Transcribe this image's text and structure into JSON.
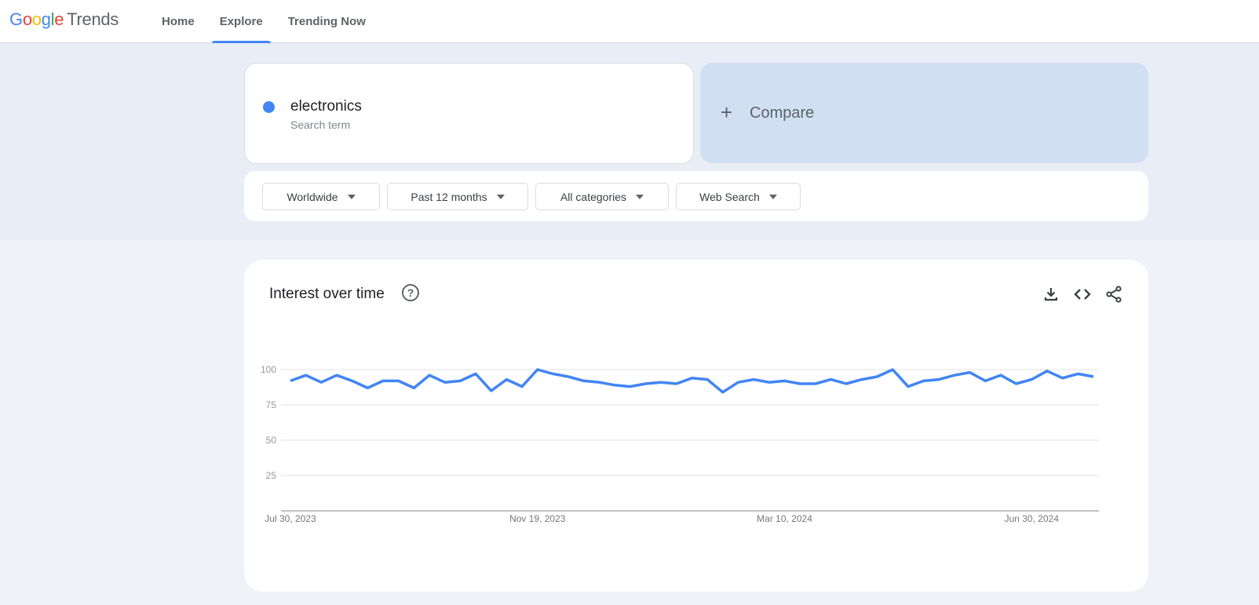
{
  "header": {
    "logo_google": "Google",
    "logo_trends": "Trends",
    "nav": [
      {
        "label": "Home",
        "active": false
      },
      {
        "label": "Explore",
        "active": true
      },
      {
        "label": "Trending Now",
        "active": false
      }
    ]
  },
  "search": {
    "term": "electronics",
    "term_type": "Search term",
    "term_color": "#4285f4",
    "compare_label": "Compare",
    "compare_icon": "plus-icon"
  },
  "filters": [
    {
      "label": "Worldwide"
    },
    {
      "label": "Past 12 months"
    },
    {
      "label": "All categories"
    },
    {
      "label": "Web Search"
    }
  ],
  "chart_card": {
    "title": "Interest over time",
    "help_icon": "help-circle-icon",
    "actions": [
      "download-icon",
      "embed-code-icon",
      "share-icon"
    ]
  },
  "chart_data": {
    "type": "line",
    "title": "Interest over time",
    "xlabel": "",
    "ylabel": "",
    "ylim": [
      0,
      100
    ],
    "yticks": [
      25,
      50,
      75,
      100
    ],
    "xtick_labels": [
      "Jul 30, 2023",
      "Nov 19, 2023",
      "Mar 10, 2024",
      "Jun 30, 2024"
    ],
    "xtick_indices": [
      0,
      16,
      32,
      48
    ],
    "grid": true,
    "series": [
      {
        "name": "electronics",
        "color": "#4285f4",
        "values": [
          92,
          96,
          91,
          96,
          92,
          87,
          92,
          92,
          87,
          96,
          91,
          92,
          97,
          85,
          93,
          88,
          100,
          97,
          95,
          92,
          91,
          89,
          88,
          90,
          91,
          90,
          94,
          93,
          84,
          91,
          93,
          91,
          92,
          90,
          90,
          93,
          90,
          93,
          95,
          100,
          88,
          92,
          93,
          96,
          98,
          92,
          96,
          90,
          93,
          99,
          94,
          97,
          95
        ]
      }
    ]
  }
}
